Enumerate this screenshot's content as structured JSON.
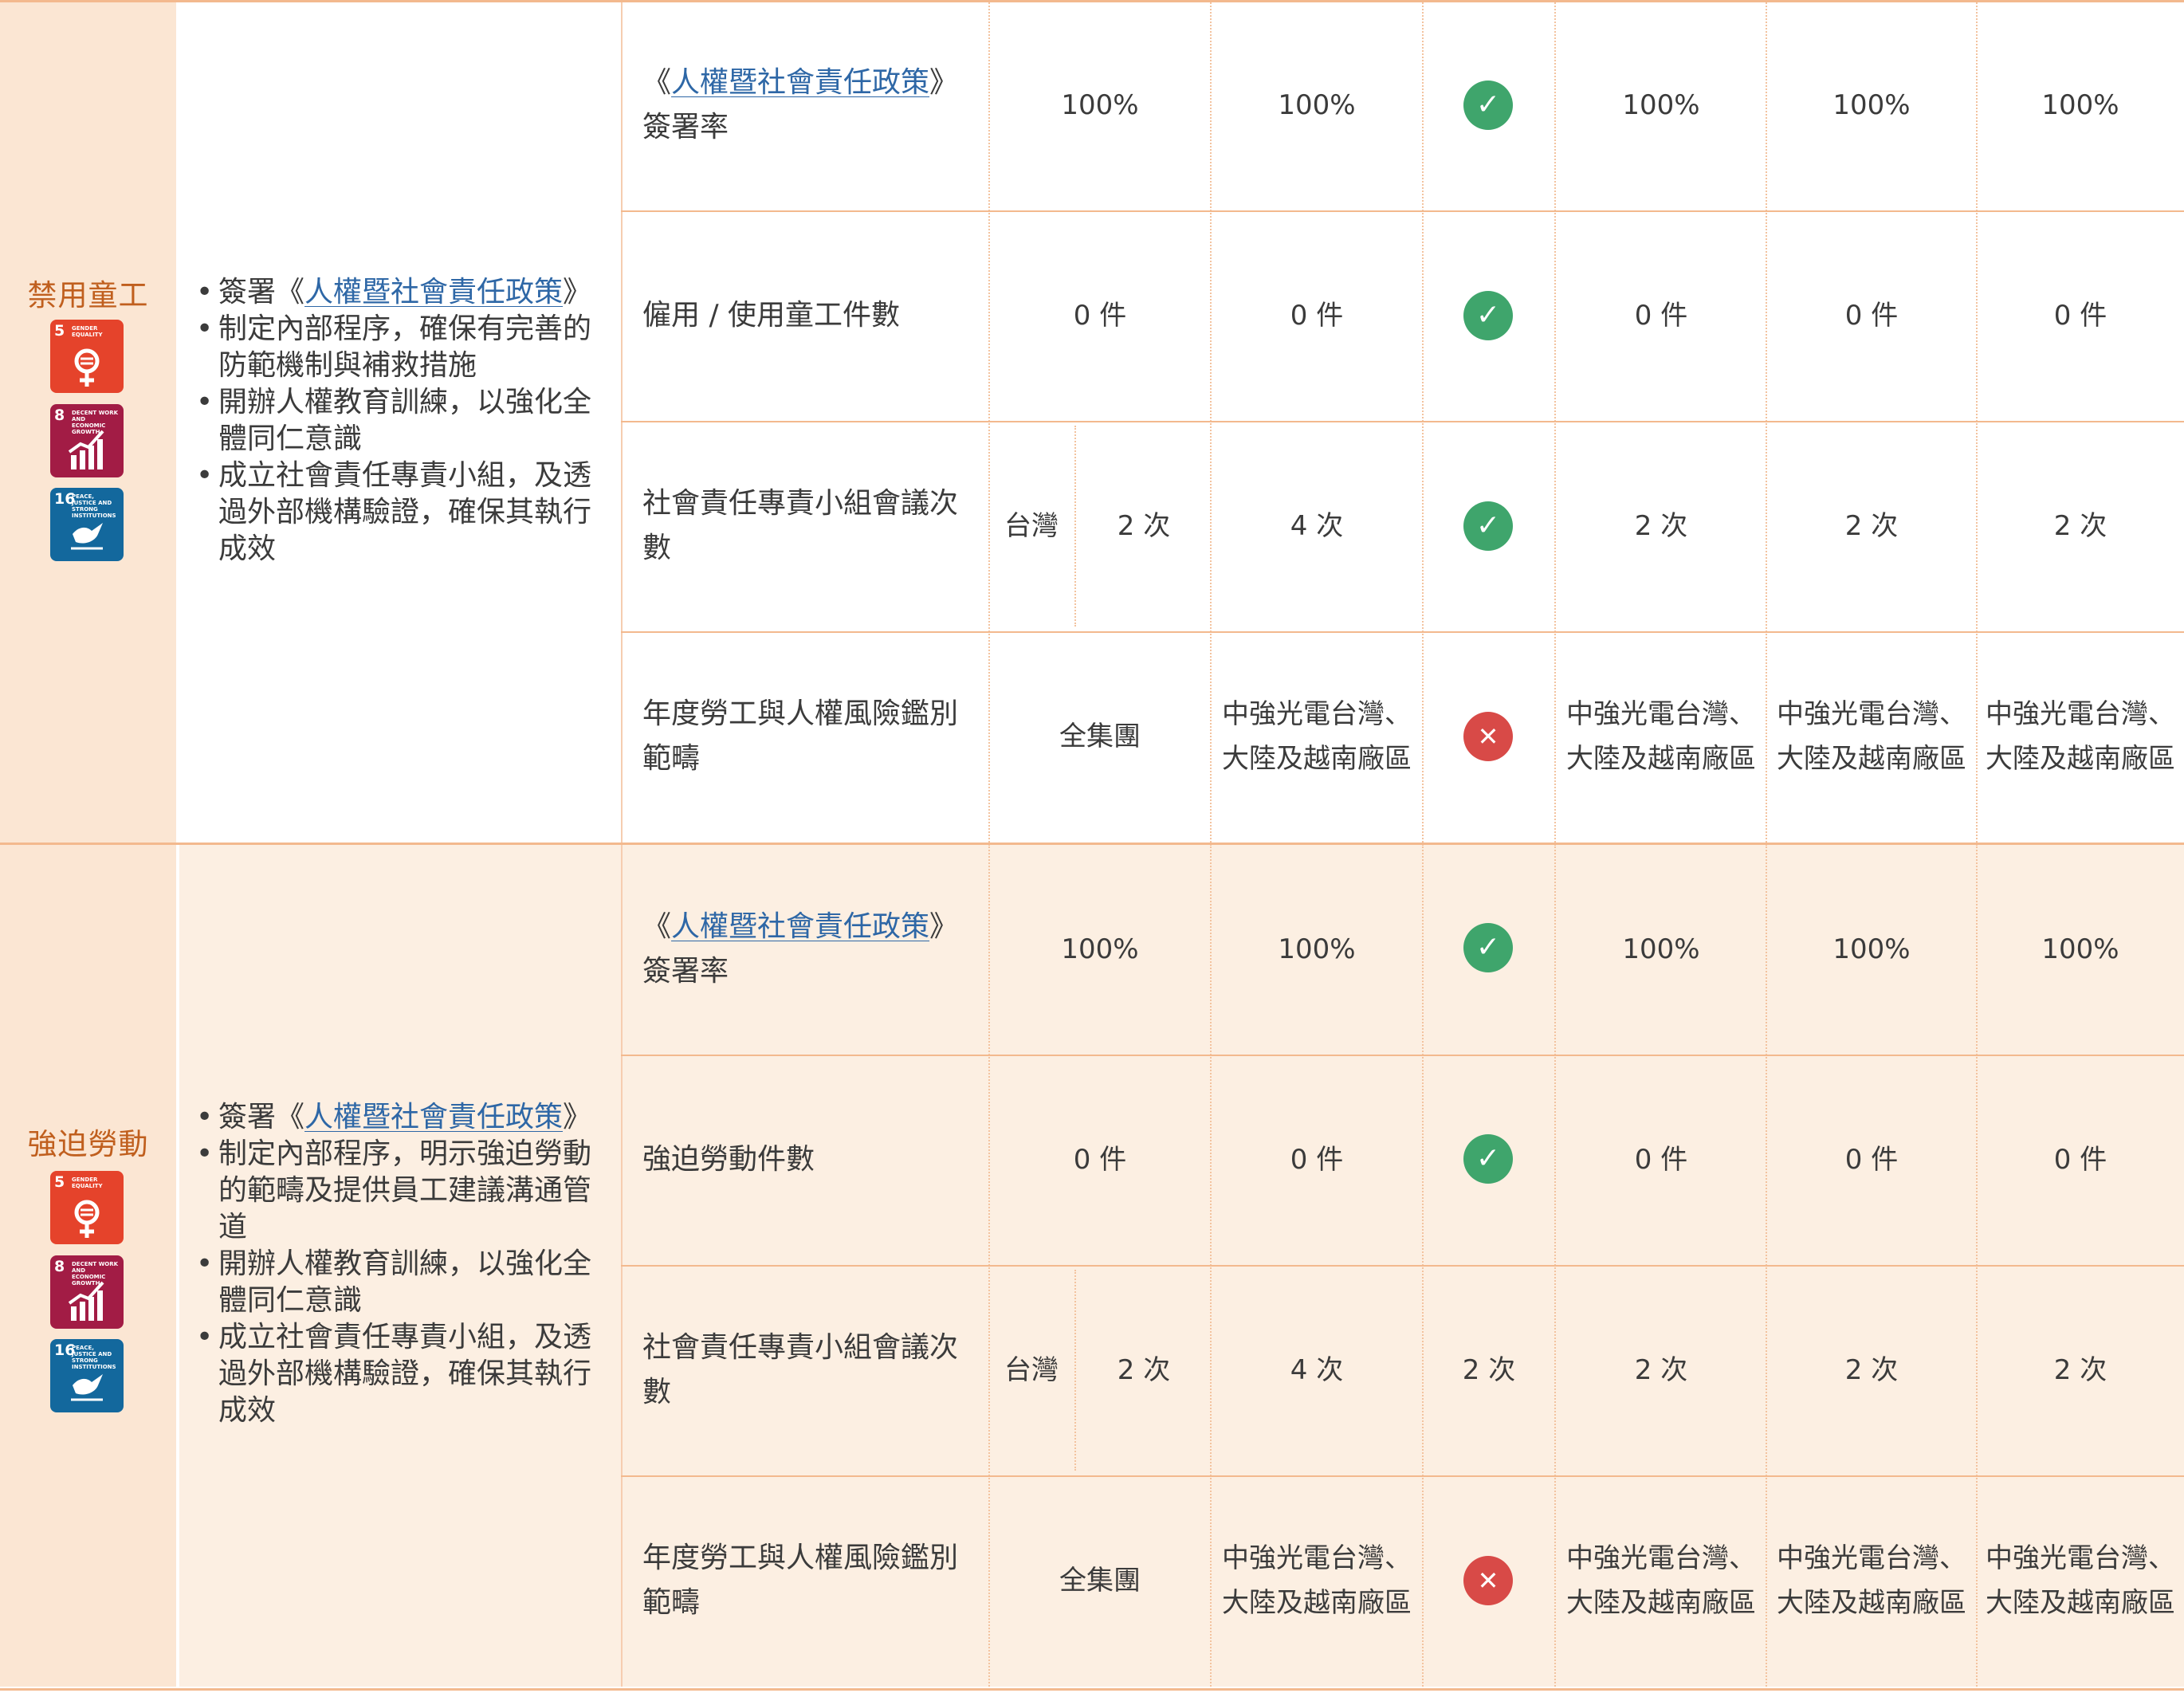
{
  "policy_name": "人權暨社會責任政策",
  "sections": [
    {
      "topic": "禁用童工",
      "sdgs": [
        {
          "num": "5",
          "label": "GENDER EQUALITY",
          "icon": "gender-equality-icon"
        },
        {
          "num": "8",
          "label": "DECENT WORK AND ECONOMIC GROWTH",
          "icon": "growth-chart-icon"
        },
        {
          "num": "16",
          "label": "PEACE, JUSTICE AND STRONG INSTITUTIONS",
          "icon": "dove-icon"
        }
      ],
      "actions": [
        {
          "prefix": "簽署《",
          "link": "人權暨社會責任政策",
          "suffix": "》"
        },
        {
          "text": "制定內部程序，確保有完善的防範機制與補救措施"
        },
        {
          "text": "開辦人權教育訓練，以強化全體同仁意識"
        },
        {
          "text": "成立社會責任專責小組，及透過外部機構驗證，確保其執行成效"
        }
      ],
      "rows": [
        {
          "ind_prefix": "《",
          "ind_link": "人權暨社會責任政策",
          "ind_suffix": "》",
          "ind_rest": "簽署率",
          "c1": "100%",
          "c2": "100%",
          "status": "check",
          "c3": "100%",
          "c4": "100%",
          "c5": "100%"
        },
        {
          "indicator": "僱用 / 使用童工件數",
          "c1": "0 件",
          "c2": "0 件",
          "status": "check",
          "c3": "0 件",
          "c4": "0 件",
          "c5": "0 件"
        },
        {
          "indicator": "社會責任專責小組會議次數",
          "region": "台灣",
          "c1": "2 次",
          "c2": "4 次",
          "status": "check",
          "c3": "2 次",
          "c4": "2 次",
          "c5": "2 次"
        },
        {
          "indicator": "年度勞工與人權風險鑑別範疇",
          "c1": "全集團",
          "c2": "中強光電台灣、大陸及越南廠區",
          "status": "cross",
          "c3": "中強光電台灣、大陸及越南廠區",
          "c4": "中強光電台灣、大陸及越南廠區",
          "c5": "中強光電台灣、大陸及越南廠區"
        }
      ]
    },
    {
      "topic": "強迫勞動",
      "sdgs": [
        {
          "num": "5",
          "label": "GENDER EQUALITY",
          "icon": "gender-equality-icon"
        },
        {
          "num": "8",
          "label": "DECENT WORK AND ECONOMIC GROWTH",
          "icon": "growth-chart-icon"
        },
        {
          "num": "16",
          "label": "PEACE, JUSTICE AND STRONG INSTITUTIONS",
          "icon": "dove-icon"
        }
      ],
      "actions": [
        {
          "prefix": "簽署《",
          "link": "人權暨社會責任政策",
          "suffix": "》"
        },
        {
          "text": "制定內部程序，明示強迫勞動的範疇及提供員工建議溝通管道"
        },
        {
          "text": "開辦人權教育訓練，以強化全體同仁意識"
        },
        {
          "text": "成立社會責任專責小組，及透過外部機構驗證，確保其執行成效"
        }
      ],
      "rows": [
        {
          "ind_prefix": "《",
          "ind_link": "人權暨社會責任政策",
          "ind_suffix": "》",
          "ind_rest": "簽署率",
          "c1": "100%",
          "c2": "100%",
          "status": "check",
          "c3": "100%",
          "c4": "100%",
          "c5": "100%"
        },
        {
          "indicator": "強迫勞動件數",
          "c1": "0 件",
          "c2": "0 件",
          "status": "check",
          "c3": "0 件",
          "c4": "0 件",
          "c5": "0 件"
        },
        {
          "indicator": "社會責任專責小組會議次數",
          "region": "台灣",
          "c1": "2 次",
          "c2": "4 次",
          "status_text": "2 次",
          "c3": "2 次",
          "c4": "2 次",
          "c5": "2 次"
        },
        {
          "indicator": "年度勞工與人權風險鑑別範疇",
          "c1": "全集團",
          "c2": "中強光電台灣、大陸及越南廠區",
          "status": "cross",
          "c3": "中強光電台灣、大陸及越南廠區",
          "c4": "中強光電台灣、大陸及越南廠區",
          "c5": "中強光電台灣、大陸及越南廠區"
        }
      ]
    }
  ],
  "colors": {
    "topic_bg": "#fbe6d3",
    "section2_bg": "#fcefe2",
    "border": "#f3b98e",
    "topic_text": "#c05f1e",
    "link": "#2e67a6",
    "check": "#3fa56c",
    "cross": "#d84a47"
  }
}
